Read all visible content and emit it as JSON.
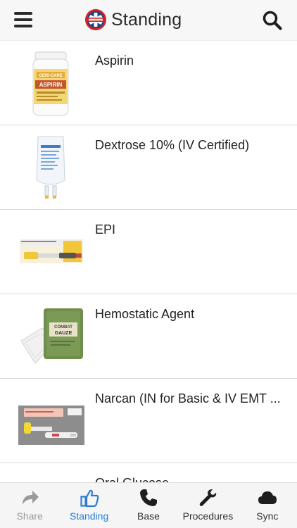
{
  "header": {
    "title": "Standing",
    "menu_icon": "hamburger-menu-icon",
    "search_icon": "search-icon",
    "logo": "star-of-life-badge-logo"
  },
  "items": [
    {
      "name": "Aspirin",
      "label_text": [
        "GERI-CARE",
        "ASPIRIN"
      ]
    },
    {
      "name": "Dextrose 10% (IV Certified)"
    },
    {
      "name": "EPI"
    },
    {
      "name": "Hemostatic Agent",
      "label_text": [
        "COMBAT",
        "GAUZE"
      ]
    },
    {
      "name": "Narcan (IN for Basic & IV EMT ..."
    },
    {
      "name": "Oral Glucose"
    }
  ],
  "tabs": [
    {
      "label": "Share",
      "icon": "share-arrow-icon",
      "state": "disabled"
    },
    {
      "label": "Standing",
      "icon": "thumbs-up-icon",
      "state": "active"
    },
    {
      "label": "Base",
      "icon": "phone-icon",
      "state": "normal"
    },
    {
      "label": "Procedures",
      "icon": "wrench-icon",
      "state": "normal"
    },
    {
      "label": "Sync",
      "icon": "cloud-icon",
      "state": "normal"
    }
  ],
  "colors": {
    "accent": "#2b7bd6",
    "disabled": "#9a9a9a",
    "divider": "#d9d9d9"
  }
}
